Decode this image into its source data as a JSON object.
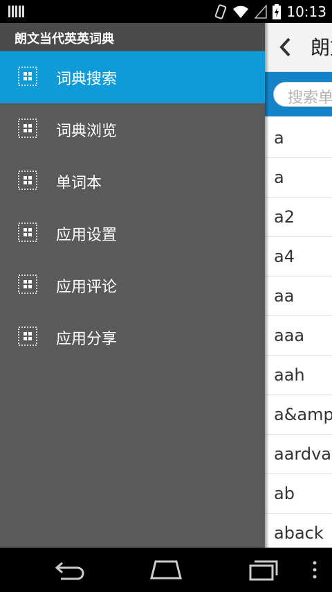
{
  "status_bar": {
    "time": "10:13"
  },
  "drawer": {
    "title": "朗文当代英英词典",
    "items": [
      {
        "label": "词典搜索",
        "selected": true
      },
      {
        "label": "词典浏览",
        "selected": false
      },
      {
        "label": "单词本",
        "selected": false
      },
      {
        "label": "应用设置",
        "selected": false
      },
      {
        "label": "应用评论",
        "selected": false
      },
      {
        "label": "应用分享",
        "selected": false
      }
    ]
  },
  "main": {
    "title": "朗文",
    "search_placeholder": "搜索单",
    "words": [
      "a",
      "a",
      "a2",
      "a4",
      "aa",
      "aaa",
      "aah",
      "a&amp;",
      "aardvar",
      "ab",
      "aback"
    ]
  },
  "colors": {
    "drawer_bg": "#5a5a5a",
    "selected_item": "#0f9ad8",
    "search_bar": "#1384c8"
  }
}
